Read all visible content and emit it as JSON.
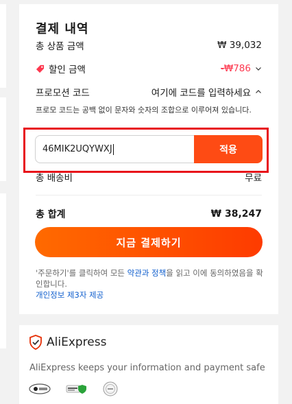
{
  "summary": {
    "title": "결제 내역",
    "subtotal_label": "총 상품 금액",
    "subtotal_value": "₩ 39,032",
    "discount_label": "할인 금액",
    "discount_currency": "-₩",
    "discount_amount": "786",
    "promo_label": "프로모션 코드",
    "promo_toggle": "여기에 코드를 입력하세요",
    "promo_hint": "프로모 코드는 공백 없이 문자와 숫자의 조합으로 이루어져 있습니다.",
    "promo_value": "46MIK2UQYWXJ",
    "apply_label": "적용",
    "shipping_label": "총 배송비",
    "shipping_value": "무료",
    "total_label": "총 합계",
    "total_value": "₩ 38,247",
    "pay_label": "지금 결제하기",
    "legal_prefix": "'주문하기'를 클릭하여 모든 ",
    "legal_link": "약관과 정책",
    "legal_suffix": "을 읽고 이에 동의하였음을 확인합니다.",
    "privacy_link": "개인정보 제3자 제공"
  },
  "trust": {
    "brand": "AliExpress",
    "safe_text": "AliExpress keeps your information and payment safe"
  },
  "colors": {
    "accent": "#fe4b14",
    "discount": "#fd384f",
    "link": "#1260ce",
    "highlight_border": "#e8101a"
  },
  "icons": [
    "tag-icon",
    "chevron-down-icon",
    "chevron-up-icon",
    "shield-check-icon",
    "security-badge-icon",
    "ssl-badge-icon",
    "certified-badge-icon"
  ]
}
